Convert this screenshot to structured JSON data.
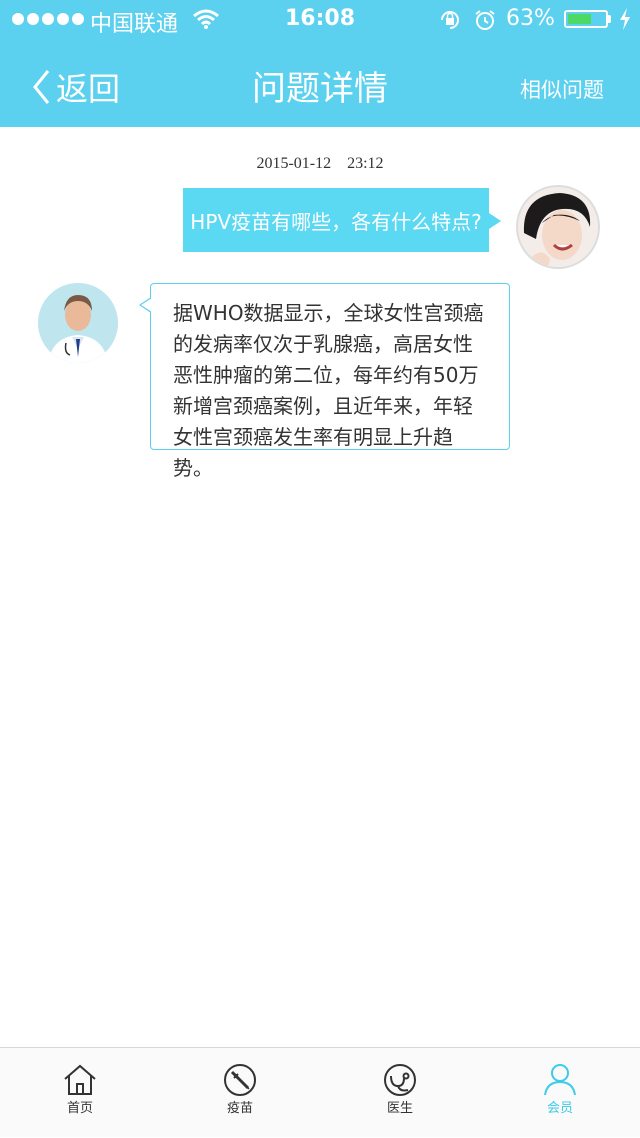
{
  "status_bar": {
    "carrier": "中国联通",
    "time": "16:08",
    "battery_percent": "63%",
    "battery_level": 0.63,
    "icons": [
      "signal-dots",
      "wifi-icon",
      "rotation-lock-icon",
      "alarm-icon",
      "battery-icon",
      "charging-icon"
    ]
  },
  "nav": {
    "back_label": "返回",
    "title": "问题详情",
    "right_action": "相似问题"
  },
  "chat": {
    "timestamp": "2015-01-12　23:12",
    "messages": [
      {
        "sender": "user",
        "text": "HPV疫苗有哪些，各有什么特点?"
      },
      {
        "sender": "doctor",
        "text": "据WHO数据显示，全球女性宫颈癌的发病率仅次于乳腺癌，高居女性恶性肿瘤的第二位，每年约有50万新增宫颈癌案例，且近年来，年轻女性宫颈癌发生率有明显上升趋势。"
      }
    ]
  },
  "tabbar": {
    "items": [
      {
        "label": "首页",
        "icon": "home-icon",
        "active": false
      },
      {
        "label": "疫苗",
        "icon": "syringe-icon",
        "active": false
      },
      {
        "label": "医生",
        "icon": "doctor-icon",
        "active": false
      },
      {
        "label": "会员",
        "icon": "user-icon",
        "active": true
      }
    ]
  },
  "colors": {
    "header": "#5bd0ef",
    "accent": "#3ccbe8",
    "user_bubble": "#5bd8f2",
    "battery": "#4cd964"
  }
}
